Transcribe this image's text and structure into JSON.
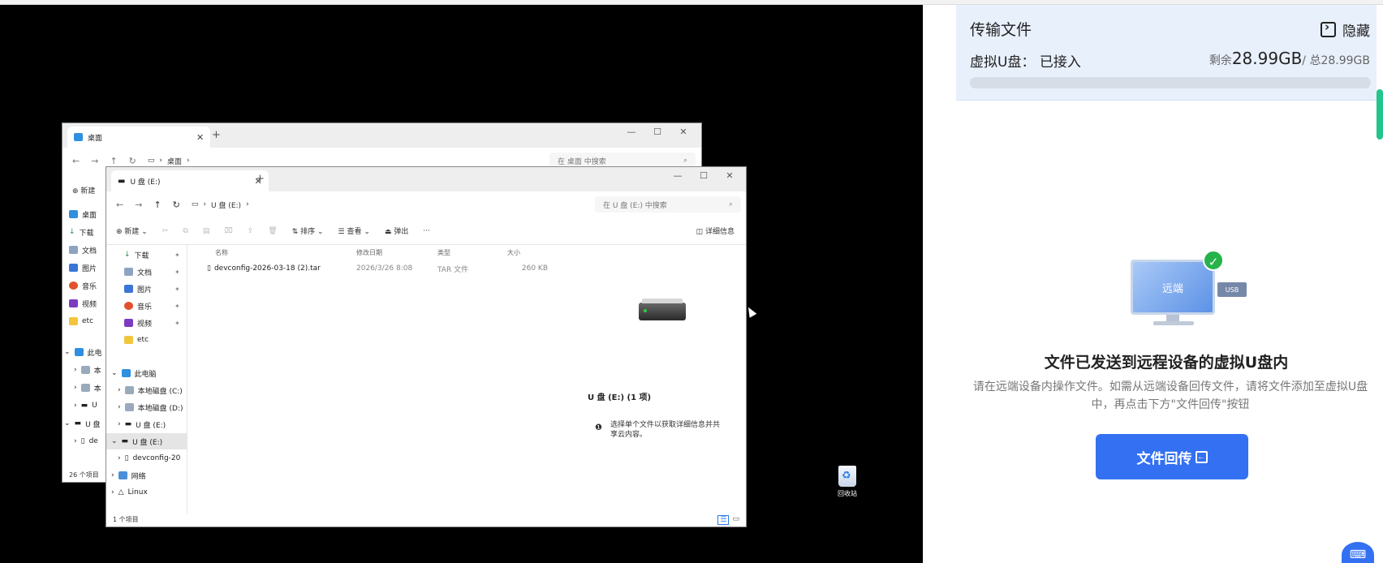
{
  "back_window": {
    "tab_label": "桌面",
    "breadcrumb": [
      "桌面"
    ],
    "search_placeholder": "在 桌面 中搜索",
    "new_label": "新建",
    "sidebar": [
      "桌面",
      "下载",
      "文档",
      "图片",
      "音乐",
      "视频",
      "etc",
      "此电",
      "本",
      "本",
      "U",
      "U 盘",
      "de"
    ],
    "status": "26 个项目"
  },
  "front_window": {
    "tab_label": "U 盘 (E:)",
    "breadcrumb": [
      "U 盘 (E:)"
    ],
    "search_placeholder": "在 U 盘 (E:) 中搜索",
    "toolbar": {
      "new": "新建",
      "sort": "排序",
      "view": "查看",
      "eject": "弹出",
      "more": "···",
      "details": "详细信息"
    },
    "sidebar": [
      {
        "label": "下载",
        "pin": true
      },
      {
        "label": "文档",
        "pin": true
      },
      {
        "label": "图片",
        "pin": true
      },
      {
        "label": "音乐",
        "pin": true
      },
      {
        "label": "视频",
        "pin": true
      },
      {
        "label": "etc",
        "pin": false
      },
      {
        "label": "此电脑",
        "pin": false
      },
      {
        "label": "本地磁盘 (C:)",
        "pin": false
      },
      {
        "label": "本地磁盘 (D:)",
        "pin": false
      },
      {
        "label": "U 盘 (E:)",
        "pin": false
      },
      {
        "label": "U 盘 (E:)",
        "pin": false
      },
      {
        "label": "devconfig-20",
        "pin": false
      },
      {
        "label": "网络",
        "pin": false
      },
      {
        "label": "Linux",
        "pin": false
      }
    ],
    "columns": [
      "名称",
      "修改日期",
      "类型",
      "大小"
    ],
    "files": [
      {
        "name": "devconfig-2026-03-18 (2).tar",
        "date": "2026/3/26 8:08",
        "type": "TAR 文件",
        "size": "260 KB"
      }
    ],
    "detail_title": "U 盘 (E:) (1 项)",
    "detail_info": "选择单个文件以获取详细信息并共享云内容。",
    "status": "1 个项目"
  },
  "desktop": {
    "recycle_label": "回收站"
  },
  "panel": {
    "title": "传输文件",
    "hide_label": "隐藏",
    "status": "虚拟U盘： 已接入",
    "remaining_prefix": "剩余",
    "remaining_value": "28.99GB",
    "total_text": " / 总28.99GB",
    "usage_fraction": 0.0,
    "illustration_screen_label": "远端",
    "illustration_usb_label": "USB",
    "message_title": "文件已发送到远程设备的虚拟U盘内",
    "message_body": "请在远端设备内操作文件。如需从远端设备回传文件，请将文件添加至虚拟U盘中，再点击下方\"文件回传\"按钮",
    "back_button_label": "文件回传",
    "colors": {
      "accent": "#3471f2",
      "header_bg": "#e8f0fc",
      "success": "#26b34a"
    }
  }
}
